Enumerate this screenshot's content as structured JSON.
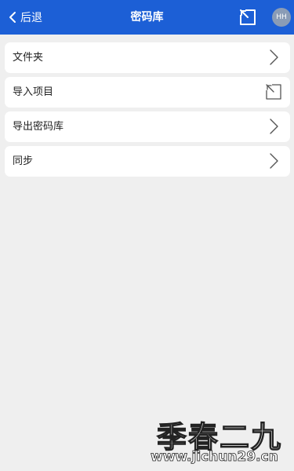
{
  "header": {
    "back_label": "后退",
    "title": "密码库",
    "share_icon": "share-export-icon",
    "avatar_initials": "HH",
    "background_color": "#1c5fd6"
  },
  "items": [
    {
      "label": "文件夹",
      "icon": "chevron-right-icon"
    },
    {
      "label": "导入项目",
      "icon": "import-icon"
    },
    {
      "label": "导出密码库",
      "icon": "chevron-right-icon"
    },
    {
      "label": "同步",
      "icon": "chevron-right-icon"
    }
  ],
  "watermark": {
    "title": "季春二九",
    "url": "www.jichun29.cn"
  }
}
